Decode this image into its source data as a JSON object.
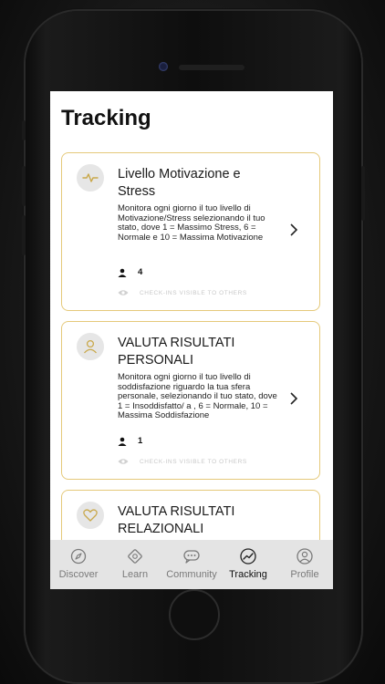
{
  "header": {
    "title": "Tracking"
  },
  "cards": [
    {
      "title": "Livello Motivazione e Stress",
      "description": "Monitora ogni giorno il tuo livello di Motivazione/Stress selezionando il tuo stato, dove 1 = Massimo Stress, 6 = Normale e 10 = Massima Motivazione",
      "count": "4",
      "visibility": "CHECK-INS VISIBLE TO OTHERS",
      "icon": "pulse-icon"
    },
    {
      "title": "VALUTA RISULTATI PERSONALI",
      "description": "Monitora ogni giorno il tuo livello di soddisfazione riguardo la tua sfera personale, selezionando il tuo stato, dove 1 = Insoddisfatto/ a , 6 = Normale, 10 = Massima Soddisfazione",
      "count": "1",
      "visibility": "CHECK-INS VISIBLE TO OTHERS",
      "icon": "person-icon"
    },
    {
      "title": "VALUTA RISULTATI RELAZIONALI",
      "icon": "heart-icon"
    }
  ],
  "tabs": [
    {
      "label": "Discover",
      "icon": "compass-icon"
    },
    {
      "label": "Learn",
      "icon": "learn-icon"
    },
    {
      "label": "Community",
      "icon": "chat-bubble-icon"
    },
    {
      "label": "Tracking",
      "icon": "trend-icon",
      "active": true
    },
    {
      "label": "Profile",
      "icon": "profile-icon"
    }
  ]
}
